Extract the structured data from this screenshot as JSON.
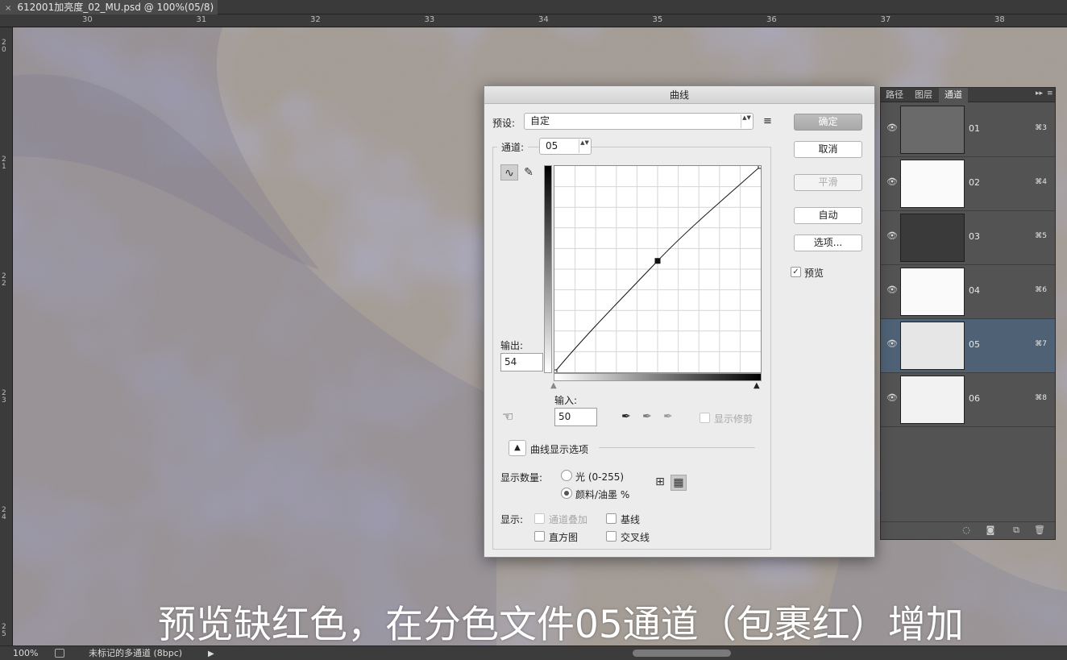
{
  "document": {
    "tab_title": "612001加亮度_02_MU.psd @ 100%(05/8)",
    "close_glyph": "×"
  },
  "rulers": {
    "horizontal": [
      "30",
      "31",
      "32",
      "33",
      "34",
      "35",
      "36",
      "37",
      "38"
    ],
    "vertical": [
      "20",
      "21",
      "22",
      "23",
      "24",
      "25"
    ]
  },
  "caption": "预览缺红色，在分色文件05通道（包裹红）增加",
  "status": {
    "zoom": "100%",
    "doc_info": "未标记的多通道 (8bpc)",
    "arrow": "▶"
  },
  "channels_panel": {
    "tabs": [
      "路径",
      "图层",
      "通道"
    ],
    "active_tab": "通道",
    "menu_glyph": "▸▸",
    "options_glyph": "≡",
    "channels": [
      {
        "name": "01",
        "shortcut": "⌘3",
        "thumb": "dark-gray"
      },
      {
        "name": "02",
        "shortcut": "⌘4",
        "thumb": "white"
      },
      {
        "name": "03",
        "shortcut": "⌘5",
        "thumb": "very-dark"
      },
      {
        "name": "04",
        "shortcut": "⌘6",
        "thumb": "white"
      },
      {
        "name": "05",
        "shortcut": "⌘7",
        "thumb": "light"
      },
      {
        "name": "06",
        "shortcut": "⌘8",
        "thumb": "light-white"
      }
    ],
    "selected": "05",
    "eye_glyph": "👁",
    "bottom_icons": [
      "◌",
      "◙",
      "⧉",
      "🗑"
    ]
  },
  "curves_dialog": {
    "title": "曲线",
    "preset_label": "预设:",
    "preset_value": "自定",
    "preset_menu_glyph": "≡",
    "channel_label": "通道:",
    "channel_value": "05",
    "output_label": "输出:",
    "output_value": "54",
    "input_label": "输入:",
    "input_value": "50",
    "show_clipping": "显示修剪",
    "curve_options_label": "曲线显示选项",
    "show_amount_label": "显示数量:",
    "light_option": "光 (0-255)",
    "pigment_option": "颜料/油墨 %",
    "show_label": "显示:",
    "channel_overlays": "通道叠加",
    "baseline": "基线",
    "histogram": "直方图",
    "intersection": "交叉线",
    "buttons": {
      "ok": "确定",
      "cancel": "取消",
      "smooth": "平滑",
      "auto": "自动",
      "options": "选项..."
    },
    "preview_label": "预览",
    "preview_checked": "✓",
    "curve_points": [
      [
        0,
        0
      ],
      [
        50,
        54
      ],
      [
        100,
        100
      ]
    ],
    "expand_glyph": "▲",
    "stepper_glyph": "▲▼",
    "curve_tool_glyph": "∿",
    "pencil_glyph": "✎",
    "hand_glyph": "☜",
    "eyedropper_glyph": "⁄",
    "grid4_glyph": "⊞",
    "grid10_glyph": "▦"
  }
}
